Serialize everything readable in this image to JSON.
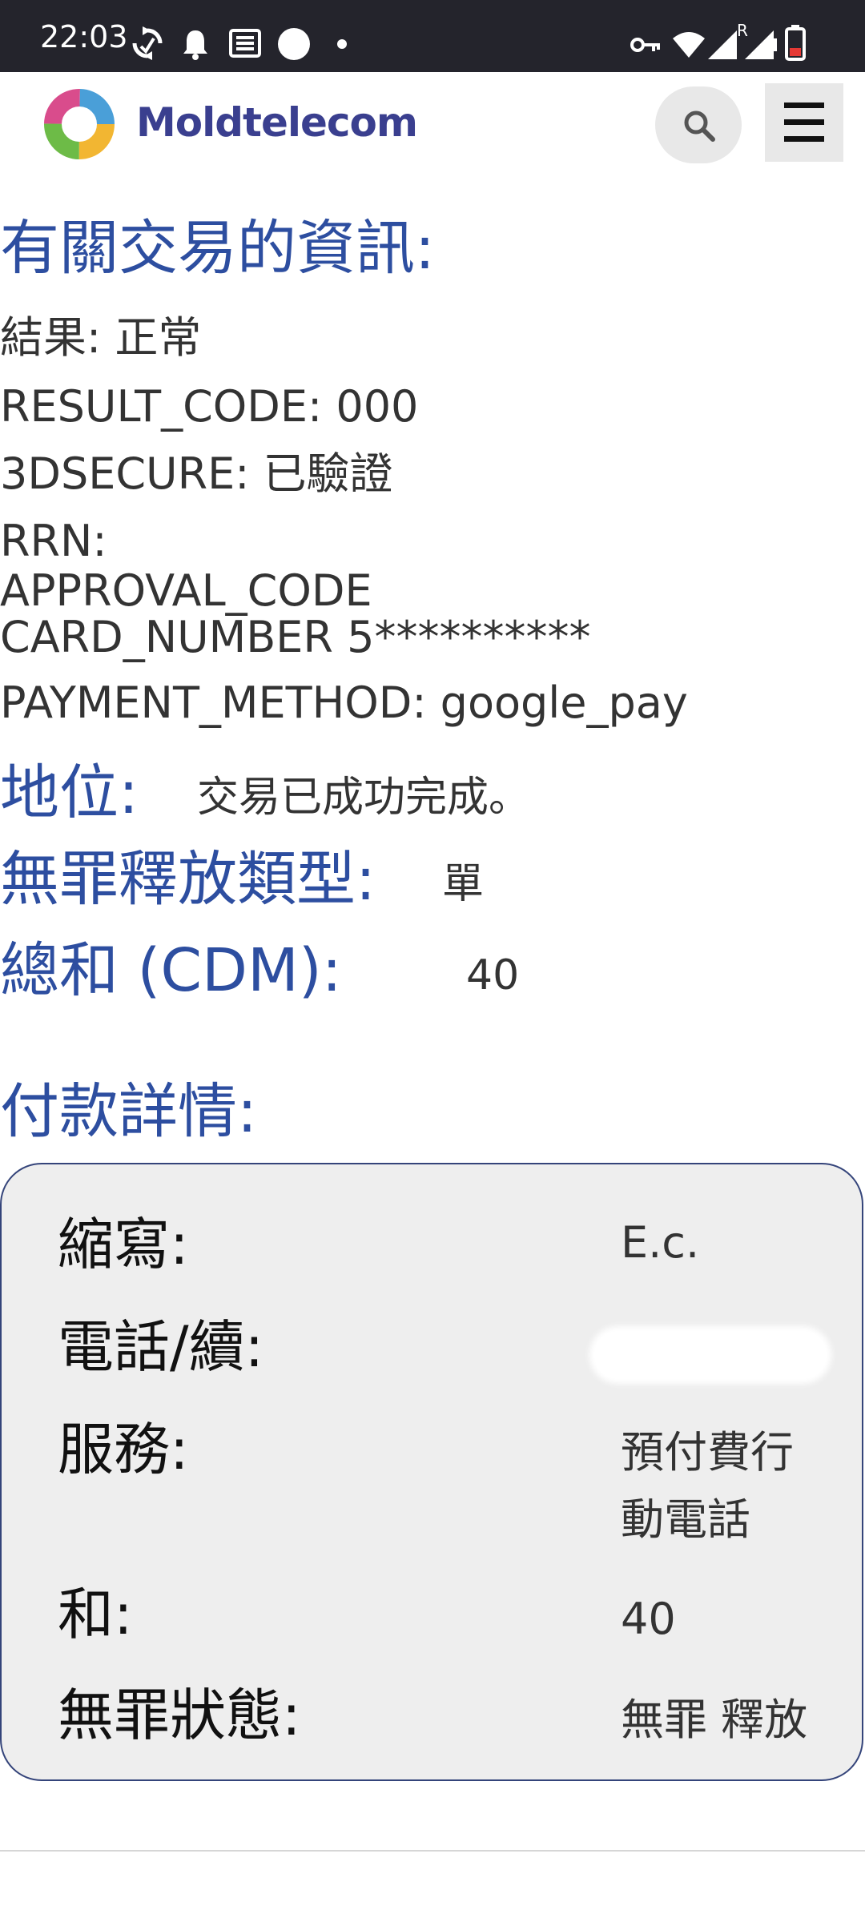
{
  "status_bar": {
    "time": "22:03",
    "icons": [
      "sync-icon",
      "notification-bell-icon",
      "news-icon",
      "circle-icon",
      "dot-icon",
      "vpn-key-icon",
      "wifi-icon",
      "signal-roaming-icon",
      "signal-icon",
      "battery-icon"
    ],
    "roaming_label": "R"
  },
  "header": {
    "brand": "Moldtelecom",
    "search_icon": "search-icon",
    "menu_icon": "hamburger-menu-icon"
  },
  "transaction_info": {
    "heading": "有關交易的資訊:",
    "result_line": "結果: 正常",
    "result_code_line": "RESULT_CODE: 000",
    "secure_line": "3DSECURE: 已驗證",
    "rrn_line": "RRN:",
    "approval_line": "APPROVAL_CODE",
    "card_line": "CARD_NUMBER 5**********",
    "payment_method_line": "PAYMENT_METHOD: google_pay"
  },
  "status": {
    "label": "地位:",
    "value": "交易已成功完成。"
  },
  "release_type": {
    "label": "無罪釋放類型:",
    "value": "單"
  },
  "total": {
    "label": "總和 (CDM):",
    "value": "40"
  },
  "payment_details": {
    "heading": "付款詳情:",
    "rows": [
      {
        "label": "縮寫:",
        "value": "E.c."
      },
      {
        "label": "電話/續:",
        "value": ""
      },
      {
        "label": "服務:",
        "value": "預付費行動電話"
      },
      {
        "label": "和:",
        "value": "40"
      },
      {
        "label": "無罪狀態:",
        "value": "無罪 釋放"
      }
    ]
  },
  "colors": {
    "status_bar_bg": "#24242c",
    "heading_blue": "#2d4ea0",
    "brand_blue": "#3a3f8f",
    "card_bg": "#eeeeee",
    "card_border": "#34447a"
  }
}
